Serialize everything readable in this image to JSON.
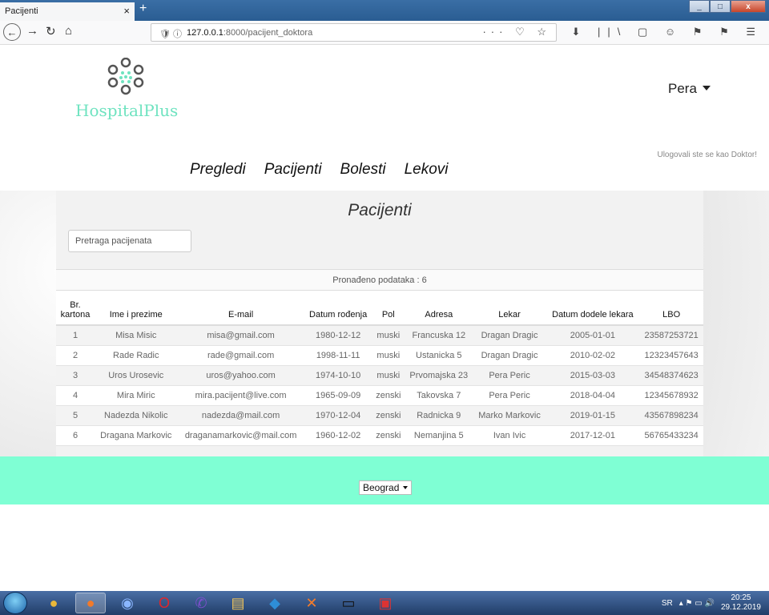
{
  "browser": {
    "tab_title": "Pacijenti",
    "tab_close": "×",
    "new_tab": "+",
    "url_host": "127.0.0.1",
    "url_rest": ":8000/pacijent_doktora",
    "url_icons": "🛡  ⓘ",
    "url_actions": "··· ♡ ☆",
    "toolbar_icons": "⬇ ||\\ ▢ ☺ ⚑ ⚑ ☰",
    "back": "←",
    "forward": "→",
    "reload": "↻",
    "home": "⌂",
    "win_min": "_",
    "win_max": "□",
    "win_close": "x"
  },
  "header": {
    "logo_text": "HospitalPlus",
    "user_name": "Pera",
    "role_text": "Ulogovali ste se kao Doktor!"
  },
  "nav": [
    "Pregledi",
    "Pacijenti",
    "Bolesti",
    "Lekovi"
  ],
  "main": {
    "title": "Pacijenti",
    "search_placeholder": "Pretraga pacijenata",
    "found_text": "Pronađeno podataka : 6",
    "columns": [
      "Br. kartona",
      "Ime i prezime",
      "E-mail",
      "Datum rođenja",
      "Pol",
      "Adresa",
      "Lekar",
      "Datum dodele lekara",
      "LBO"
    ],
    "rows": [
      [
        "1",
        "Misa Misic",
        "misa@gmail.com",
        "1980-12-12",
        "muski",
        "Francuska 12",
        "Dragan Dragic",
        "2005-01-01",
        "23587253721"
      ],
      [
        "2",
        "Rade Radic",
        "rade@gmail.com",
        "1998-11-11",
        "muski",
        "Ustanicka 5",
        "Dragan Dragic",
        "2010-02-02",
        "12323457643"
      ],
      [
        "3",
        "Uros Urosevic",
        "uros@yahoo.com",
        "1974-10-10",
        "muski",
        "Prvomajska 23",
        "Pera Peric",
        "2015-03-03",
        "34548374623"
      ],
      [
        "4",
        "Mira Miric",
        "mira.pacijent@live.com",
        "1965-09-09",
        "zenski",
        "Takovska 7",
        "Pera Peric",
        "2018-04-04",
        "12345678932"
      ],
      [
        "5",
        "Nadezda Nikolic",
        "nadezda@mail.com",
        "1970-12-04",
        "zenski",
        "Radnicka 9",
        "Marko Markovic",
        "2019-01-15",
        "43567898234"
      ],
      [
        "6",
        "Dragana Markovic",
        "draganamarkovic@mail.com",
        "1960-12-02",
        "zenski",
        "Nemanjina 5",
        "Ivan Ivic",
        "2017-12-01",
        "56765433234"
      ]
    ]
  },
  "footer": {
    "city": "Beograd"
  },
  "taskbar": {
    "lang": "SR",
    "time": "20:25",
    "date": "29.12.2019",
    "tray_icons": "▴ ⚑ ▭ 🔊",
    "apps": [
      "chrome-icon",
      "firefox-icon",
      "messenger-icon",
      "opera-icon",
      "viber-icon",
      "explorer-icon",
      "vscode-icon",
      "xampp-icon",
      "cmd-icon",
      "editor-icon"
    ]
  },
  "colors": {
    "brand": "#6fe3c0",
    "footer_bg": "#7fffd4"
  }
}
